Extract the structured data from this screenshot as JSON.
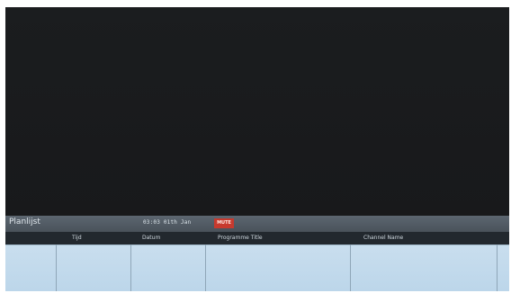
{
  "panel": {
    "title": "Planlijst",
    "clock": "03:03  01th Jan",
    "mute_badge": "MUTE"
  },
  "columns": {
    "time": "Tijd",
    "date": "Datum",
    "programme": "Programme Title",
    "channel": "Channel Name"
  },
  "colors": {
    "screen_bg": "#1a1c1e",
    "header_bar": "#4a525a",
    "column_header_bg": "#22282e",
    "grid_bg": "#c9deee",
    "mute_badge": "#c73a2e"
  }
}
